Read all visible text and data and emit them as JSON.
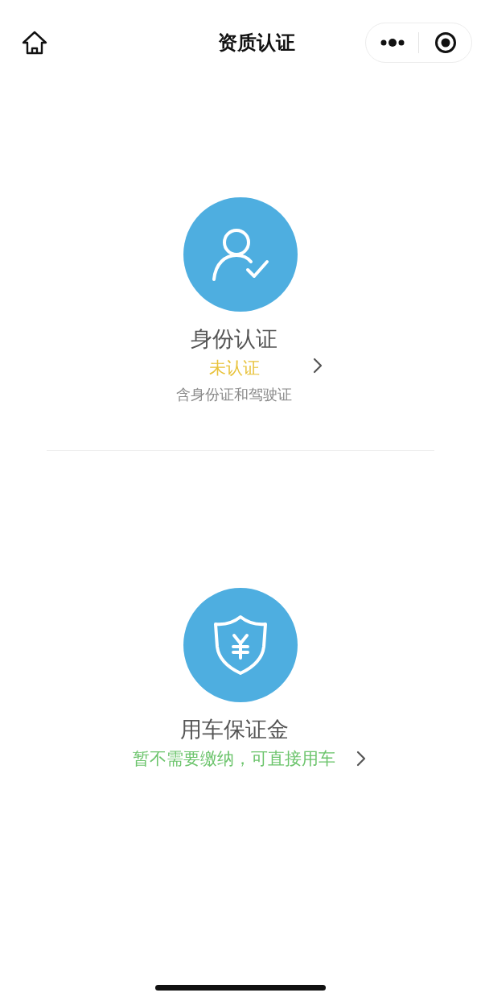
{
  "nav_bar": {
    "title": "资质认证"
  },
  "items": [
    {
      "kind": "identity",
      "title": "身份认证",
      "status": {
        "text": "未认证",
        "color": "#e8c23a"
      },
      "note": "含身份证和驾驶证"
    },
    {
      "kind": "deposit",
      "title": "用车保证金",
      "status": {
        "text": "暂不需要缴纳，可直接用车",
        "color": "#6cc46c"
      }
    }
  ]
}
